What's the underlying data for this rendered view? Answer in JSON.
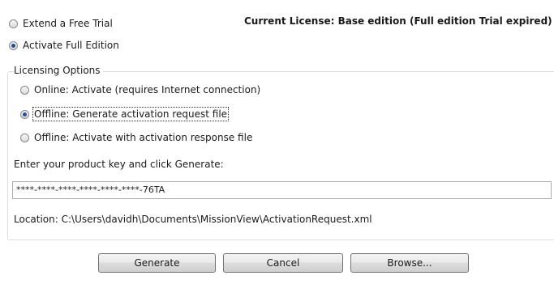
{
  "mode": {
    "options": [
      {
        "label": "Extend a Free Trial",
        "checked": false
      },
      {
        "label": "Activate Full Edition",
        "checked": true
      }
    ]
  },
  "license_status": "Current License: Base edition (Full edition Trial expired)",
  "licensing": {
    "group_title": "Licensing Options",
    "options": [
      {
        "label": "Online: Activate (requires Internet connection)",
        "checked": false
      },
      {
        "label": "Offline: Generate activation request file",
        "checked": true
      },
      {
        "label": "Offline: Activate with activation response file",
        "checked": false
      }
    ]
  },
  "product_key": {
    "prompt": "Enter your product key and click Generate:",
    "value": "****-****-****-****-****-****-76TA"
  },
  "location": "Location: C:\\Users\\davidh\\Documents\\MissionView\\ActivationRequest.xml",
  "buttons": {
    "generate": "Generate",
    "cancel": "Cancel",
    "browse": "Browse..."
  }
}
